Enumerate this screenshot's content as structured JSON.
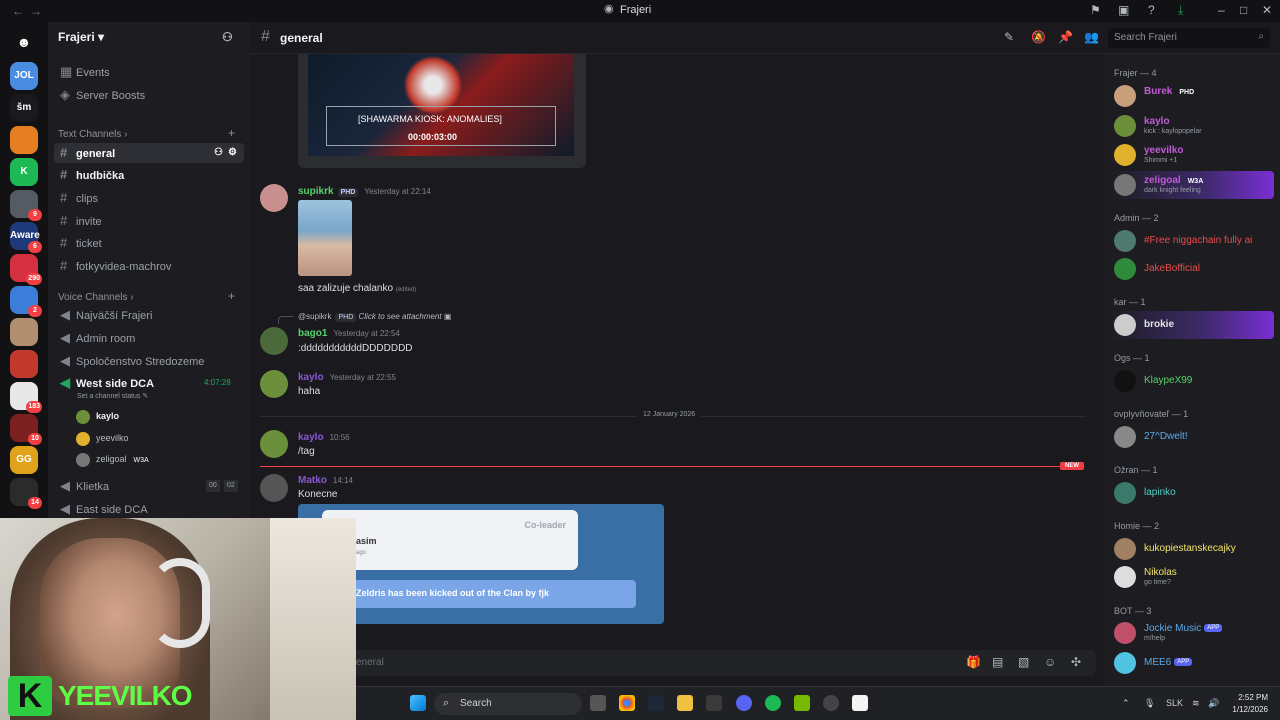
{
  "window": {
    "title": "Frajeri"
  },
  "servers": [
    {
      "label": "JOL",
      "color": "#4a8de0",
      "badge": ""
    },
    {
      "label": "šm",
      "color": "#1a1a1e",
      "badge": ""
    },
    {
      "label": "",
      "color": "#e67e22",
      "badge": ""
    },
    {
      "label": "K",
      "color": "#1db954",
      "badge": ""
    },
    {
      "label": "",
      "color": "#555a63",
      "badge": "9"
    },
    {
      "label": "Aware",
      "color": "#1f3a7a",
      "badge": "6"
    },
    {
      "label": "",
      "color": "#d63040",
      "badge": "290"
    },
    {
      "label": "",
      "color": "#3b7dd8",
      "badge": "2"
    },
    {
      "label": "",
      "color": "#b08f70",
      "badge": ""
    },
    {
      "label": "",
      "color": "#c0392b",
      "badge": ""
    },
    {
      "label": "",
      "color": "#e8e8e8",
      "badge": "183"
    },
    {
      "label": "",
      "color": "#7c1f1f",
      "badge": "10"
    },
    {
      "label": "GG",
      "color": "#e0a21a",
      "badge": ""
    },
    {
      "label": "",
      "color": "#2b2b2b",
      "badge": "14"
    }
  ],
  "guild": {
    "name": "Frajeri"
  },
  "sidebar": {
    "top_items": [
      "Events",
      "Server Boosts"
    ],
    "text_category": "Text Channels",
    "text_channels": [
      "general",
      "hudbička",
      "clips",
      "invite",
      "ticket",
      "fotkyvidea-machrov"
    ],
    "voice_category": "Voice Channels",
    "voice_channels": [
      "Najväčší Frajeri",
      "Admin room",
      "Spoločenstvo Stredozeme",
      "West side DCA",
      "Klietka",
      "East side DCA"
    ],
    "west_timer": "4:07:28",
    "west_status": "Set a channel status",
    "voice_users": [
      "kaylo",
      "yeevilko",
      "zeligoal"
    ],
    "zeligoal_tag": "W3A",
    "klietka_a": "00",
    "klietka_b": "02"
  },
  "header": {
    "channel": "general",
    "search_placeholder": "Search Frajeri"
  },
  "messages": {
    "video_title": "[SHAWARMA KIOSK: ANOMALIES]",
    "video_time": "00:00:03:00",
    "m1_author": "supikrk",
    "m1_tag": "PHD",
    "m1_time": "Yesterday at 22:14",
    "m1_text": "saa zalizuje chalanko",
    "m1_edited": "(edited)",
    "reply_author": "@supikrk",
    "reply_tag": "PHD",
    "reply_text": "Click to see attachment",
    "m2_author": "bago1",
    "m2_time": "Yesterday at 22:54",
    "m2_text": ":dddddddddddDDDDDDD",
    "m3_author": "kaylo",
    "m3_time": "Yesterday at 22:55",
    "m3_text": "haha",
    "date_divider": "12 January 2026",
    "m4_author": "kaylo",
    "m4_time": "10:56",
    "m4_text": "/tag",
    "new_label": "NEW",
    "m5_author": "Matko",
    "m5_time": "14:14",
    "m5_text": "Konecne",
    "img_coleader": "Co-leader",
    "img_name": "asim",
    "img_ago": "ago",
    "img_kicked": "Zeldris has been kicked out of the Clan by fjk"
  },
  "composer": {
    "placeholder": "eneral"
  },
  "members": {
    "group_frajer": "Frajer — 4",
    "burek": "Burek",
    "burek_tag": "PHD",
    "kaylo": "kaylo",
    "kaylo_status": "kick : kaylopopelar",
    "yeevilko": "yeevilko",
    "yeevilko_status": "Shimmi +1",
    "zeligoal": "zeligoal",
    "zeligoal_tag": "W3A",
    "zeligoal_status": "dark knight feeling",
    "group_admin": "Admin — 2",
    "admin1": "#Free niggachain fully ai",
    "admin2": "JakeBofficial",
    "group_kar": "kar — 1",
    "kar1": "brokie",
    "group_ogs": "Ogs — 1",
    "ogs1": "KlaypeX99",
    "group_ovpl": "ovplyvňovateľ — 1",
    "ovpl1": "27^Dwelt!",
    "group_ozran": "Ožran — 1",
    "ozran1": "lapinko",
    "group_homie": "Homie — 2",
    "homie1": "kukopiestanskecajky",
    "homie2": "Nikolas",
    "homie2_status": "go time?",
    "group_bot": "BOT — 3",
    "bot1": "Jockie Music",
    "bot1_status": "m!help",
    "bot2": "MEE6",
    "app_label": "APP"
  },
  "webcam": {
    "name": "YEEVILKO",
    "logo": "K"
  },
  "taskbar": {
    "search": "Search",
    "lang": "SLK",
    "time": "2:52 PM",
    "date": "1/12/2026"
  },
  "colors": {
    "accent": "#5865f2",
    "green": "#2ecc40",
    "red": "#f23f43"
  }
}
